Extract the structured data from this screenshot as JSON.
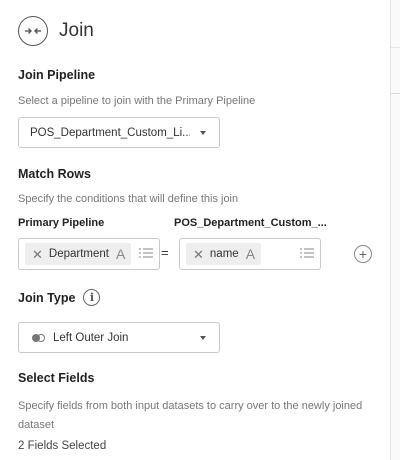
{
  "panel": {
    "title": "Join"
  },
  "join_pipeline": {
    "label": "Join Pipeline",
    "description": "Select a pipeline to join with the Primary Pipeline",
    "selected": "POS_Department_Custom_Li..."
  },
  "match_rows": {
    "label": "Match Rows",
    "description": "Specify the conditions that will define this join",
    "primary_label": "Primary Pipeline",
    "secondary_label": "POS_Department_Custom_...",
    "operator": "=",
    "left_field": {
      "name": "Department",
      "type_glyph": "A"
    },
    "right_field": {
      "name": "name",
      "type_glyph": "A"
    }
  },
  "join_type": {
    "label": "Join Type",
    "info_glyph": "i",
    "selected": "Left Outer Join"
  },
  "select_fields": {
    "label": "Select Fields",
    "description": "Specify fields from both input datasets to carry over to the newly joined dataset",
    "count_text": "2 Fields Selected"
  }
}
